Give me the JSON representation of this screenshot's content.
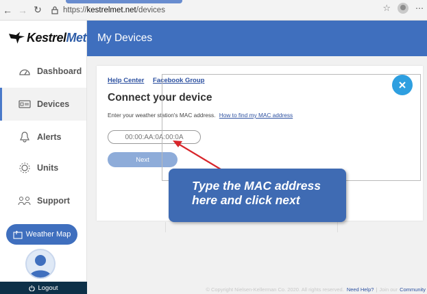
{
  "browser": {
    "url_prefix": "https://",
    "url_domain": "kestrelmet.net",
    "url_path": "/devices"
  },
  "sidebar": {
    "logo_left": "Kestrel",
    "logo_right": "Met",
    "items": [
      {
        "label": "Dashboard",
        "icon": "dashboard-icon"
      },
      {
        "label": "Devices",
        "icon": "devices-icon",
        "active": true
      },
      {
        "label": "Alerts",
        "icon": "alerts-icon"
      },
      {
        "label": "Units",
        "icon": "units-icon"
      },
      {
        "label": "Support",
        "icon": "support-icon"
      }
    ],
    "weather_map_label": "Weather Map",
    "logout_label": "Logout"
  },
  "header": {
    "title": "My Devices"
  },
  "card": {
    "help_center": "Help Center",
    "facebook_group": "Facebook Group",
    "title": "Connect your device",
    "description": "Enter your weather station's MAC address.",
    "mac_help_link": "How to find my MAC address",
    "mac_placeholder": "00:00:AA:0A:00:0A",
    "next_label": "Next"
  },
  "callout": {
    "line1": "Type the MAC address",
    "line2": "here and click next"
  },
  "footer": {
    "copyright": "© Copyright Nielsen-Kellerman Co. 2020. All rights reserved.",
    "need_help": "Need Help?",
    "join_our": "Join our",
    "community": "Community"
  },
  "colors": {
    "brand_blue": "#3f6fbe",
    "close_blue": "#2e9fe0",
    "arrow_red": "#d8262b",
    "logout_bg": "#0d3048"
  }
}
